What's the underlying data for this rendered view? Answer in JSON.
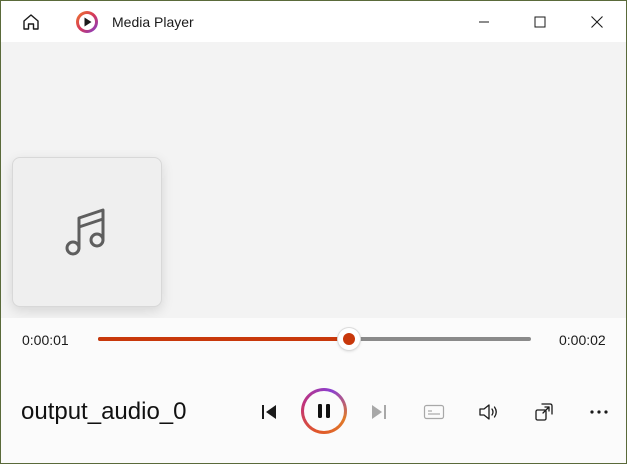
{
  "window": {
    "title": "Media Player"
  },
  "icons": {
    "home": "home-icon",
    "app_logo": "media-player-logo-icon",
    "minimize": "minimize-icon",
    "maximize": "maximize-icon",
    "close": "close-icon",
    "music_note": "music-note-icon",
    "previous": "skip-previous-icon",
    "pause": "pause-icon",
    "next": "skip-next-icon",
    "subtitles": "subtitles-icon",
    "volume": "volume-icon",
    "mini_player": "mini-player-icon",
    "more": "more-options-icon"
  },
  "player": {
    "current_time": "0:00:01",
    "total_time": "0:00:02",
    "progress_fraction": 0.58,
    "track_name": "output_audio_0"
  },
  "colors": {
    "accent": "#c8380b",
    "track_inactive": "#8a8a8a",
    "disabled_icon": "#a8a8a8",
    "icon": "#1a1a1a"
  }
}
